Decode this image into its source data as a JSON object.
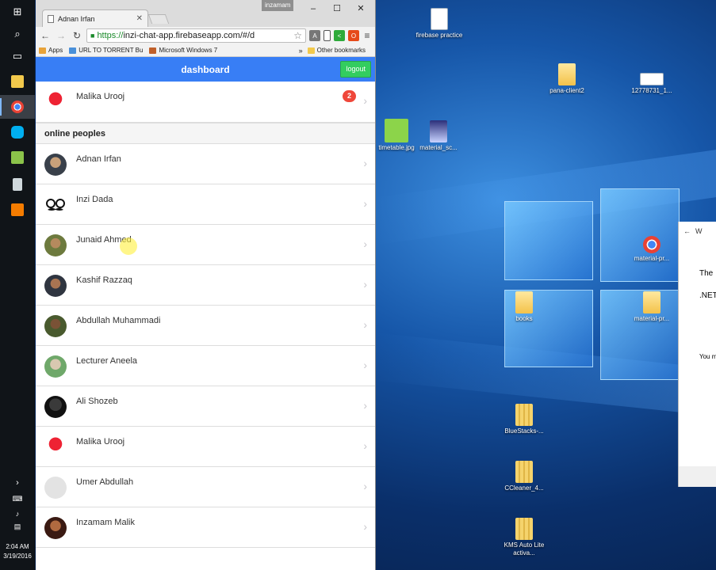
{
  "desktop": {
    "icons": [
      {
        "label": "firebase practice",
        "icon": "file-code-icon"
      },
      {
        "label": "pana-client2",
        "icon": "folder-icon"
      },
      {
        "label": "12778731_1...",
        "icon": "image-icon"
      },
      {
        "label": "timetable.jpg",
        "icon": "image-icon"
      },
      {
        "label": "material_sc...",
        "icon": "document-icon"
      },
      {
        "label": "material-pr...",
        "icon": "chrome-document-icon"
      },
      {
        "label": "books",
        "icon": "folder-icon"
      },
      {
        "label": "material-pr...",
        "icon": "folder-icon"
      },
      {
        "label": "BlueStacks-...",
        "icon": "zip-folder-icon"
      },
      {
        "label": "CCleaner_4...",
        "icon": "zip-folder-icon"
      },
      {
        "label": "KMS Auto Lite activa...",
        "icon": "zip-folder-icon"
      }
    ],
    "dialog": {
      "title_fragment": "W",
      "line1": "The",
      "line2": ".NET",
      "line3": "You m"
    }
  },
  "taskbar": {
    "time": "2:04 AM",
    "date": "3/19/2016",
    "items": [
      "windows-logo-icon",
      "search-icon",
      "task-view-icon",
      "file-explorer-icon",
      "chrome-icon",
      "skype-icon",
      "bluestacks-icon",
      "notepad-icon",
      "app-orange-icon"
    ]
  },
  "browser": {
    "tab_title": "Adnan Irfan",
    "user_badge": "inzamam",
    "url_https": "https://",
    "url_rest": "inzi-chat-app.firebaseapp.com/#/d",
    "bookmarks": [
      {
        "label": "Apps",
        "color": "#e8a33a"
      },
      {
        "label": "URL TO TORRENT Bu",
        "color": "#4a90d9"
      },
      {
        "label": "Microsoft Windows 7",
        "color": "#c0602a"
      }
    ],
    "bookmarks_more": "»",
    "other_bookmarks": "Other bookmarks"
  },
  "app": {
    "title": "dashboard",
    "logout_label": "logout",
    "top_contact": {
      "name": "Malika Urooj",
      "unread": "2"
    },
    "section_label": "online peoples",
    "online": [
      {
        "name": "Adnan Irfan"
      },
      {
        "name": "Inzi Dada"
      },
      {
        "name": "Junaid Ahmed"
      },
      {
        "name": "Kashif Razzaq"
      },
      {
        "name": "Abdullah Muhammadi"
      },
      {
        "name": "Lecturer Aneela"
      },
      {
        "name": "Ali Shozeb"
      },
      {
        "name": "Malika Urooj"
      },
      {
        "name": "Umer Abdullah"
      },
      {
        "name": "Inzamam Malik"
      }
    ]
  },
  "colors": {
    "header": "#387ef5",
    "logout": "#33cd5f",
    "badge": "#ef473a"
  }
}
